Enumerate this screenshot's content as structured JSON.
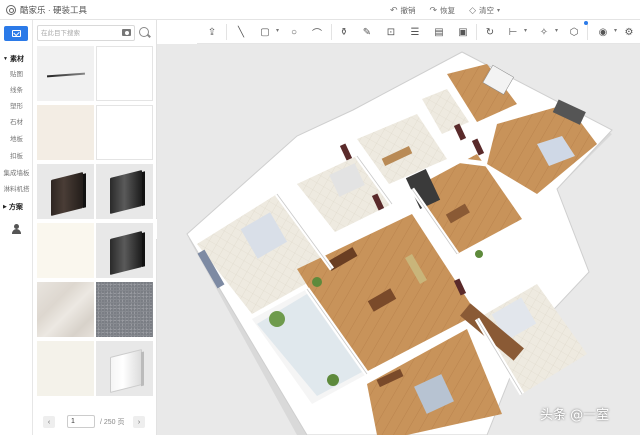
{
  "app": {
    "title": "酷家乐 · 硬装工具"
  },
  "titlebar": {
    "undo_label": "撤销",
    "redo_label": "恢复",
    "clear_label": "清空"
  },
  "rail": {
    "sections": [
      {
        "label": "素材",
        "items": [
          "贴图",
          "线条",
          "塑形",
          "石材",
          "地板",
          "扣板",
          "集成墙板",
          "淋料机搭"
        ]
      },
      {
        "label": "方案"
      }
    ]
  },
  "search": {
    "placeholder": "在此目下搜索"
  },
  "materials": [
    {
      "name": "metal-rod"
    },
    {
      "name": "plain-white"
    },
    {
      "name": "cream-panel"
    },
    {
      "name": "white-panel"
    },
    {
      "name": "dark-baseboard"
    },
    {
      "name": "black-baseboard"
    },
    {
      "name": "ivory-panel"
    },
    {
      "name": "grey-baseboard"
    },
    {
      "name": "beige-marble"
    },
    {
      "name": "grey-granite"
    },
    {
      "name": "cream-tile"
    },
    {
      "name": "white-baseboard"
    }
  ],
  "pager": {
    "page": "1",
    "total": "/ 250 页",
    "prev": "‹",
    "next": "›"
  },
  "watermark": "头条 @一室",
  "colors": {
    "accent": "#2b7ae8",
    "canvas_bg": "#e9e9e9",
    "floor_wood": "#c8935a",
    "floor_light": "#ebe6d8",
    "wall": "#ffffff"
  }
}
